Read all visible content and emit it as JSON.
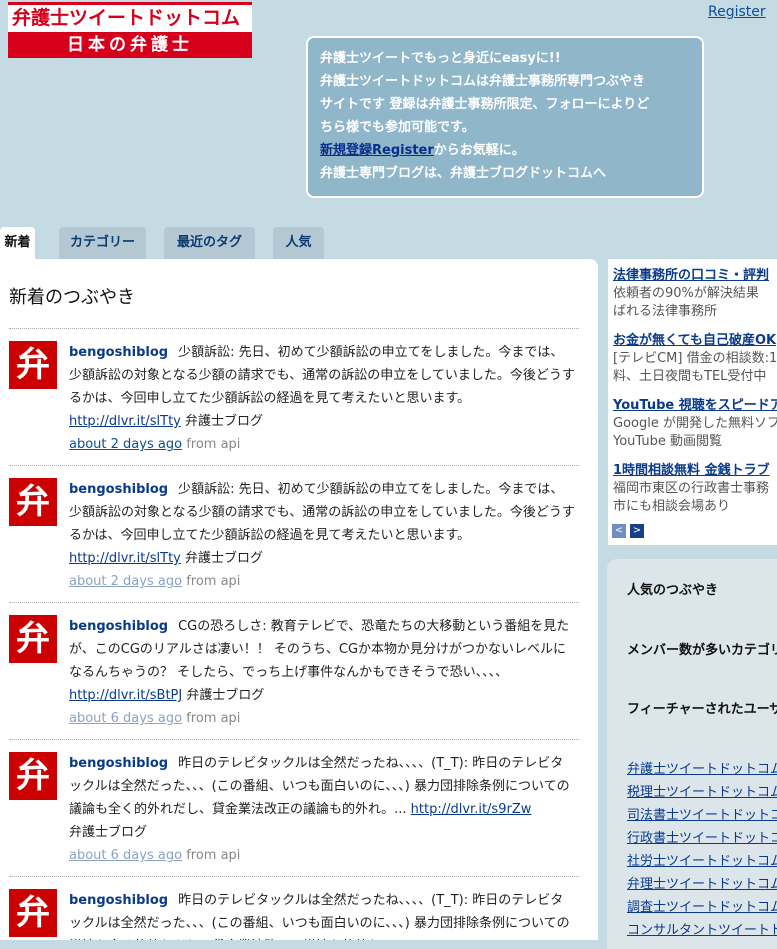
{
  "header": {
    "logo_top": "弁護士ツイートドットコム",
    "logo_bottom": "日本の弁護士",
    "register_link": "Register"
  },
  "info": {
    "line1": "弁護士ツイートでもっと身近にeasyに!!",
    "line2": "弁護士ツイートドットコムは弁護士事務所専門つぶやき",
    "line3": "サイトです 登録は弁護士事務所限定、フォローによりど",
    "line4": "ちら様でも参加可能です。",
    "signup_link": "新規登録Register",
    "line5_suffix": "からお気軽に。",
    "line6": "弁護士専門ブログは、弁護士ブログドットコムへ"
  },
  "tabs": [
    "新着",
    "カテゴリー",
    "最近のタグ",
    "人気"
  ],
  "main": {
    "title": "新着のつぶやき",
    "avatar_glyph": "弁",
    "tweets": [
      {
        "user": "bengoshiblog",
        "text": "少額訴訟: 先日、初めて少額訴訟の申立てをしました。今までは、少額訴訟の対象となる少額の請求でも、通常の訴訟の申立をしていました。今後どうするかは、今回申し立てた少額訴訟の経過を見て考えたいと思います。",
        "link": "http://dlvr.it/slTty",
        "suffix": "弁護士ブログ",
        "time": "about 2 days ago",
        "source": "from api"
      },
      {
        "user": "bengoshiblog",
        "text": "少額訴訟: 先日、初めて少額訴訟の申立てをしました。今までは、少額訴訟の対象となる少額の請求でも、通常の訴訟の申立をしていました。今後どうするかは、今回申し立てた少額訴訟の経過を見て考えたいと思います。",
        "link": "http://dlvr.it/slTty",
        "suffix": "弁護士ブログ",
        "time": "about 2 days ago",
        "source": "from api"
      },
      {
        "user": "bengoshiblog",
        "text": "CGの恐ろしさ: 教育テレビで、恐竜たちの大移動という番組を見たが、このCGのリアルさは凄い！！ そのうち、CGか本物か見分けがつかないレベルになるんちゃうの？ そしたら、でっち上げ事件なんかもできそうで恐い、、、、",
        "link": "http://dlvr.it/sBtPJ",
        "suffix": "弁護士ブログ",
        "time": "about 6 days ago",
        "source": "from api"
      },
      {
        "user": "bengoshiblog",
        "text": "昨日のテレビタックルは全然だったね、、、、(T_T): 昨日のテレビタックルは全然だった、、、(この番組、いつも面白いのに、、、) 暴力団排除条例についての議論も全く的外れだし、貸金業法改正の議論も的外れ。...",
        "link": "http://dlvr.it/s9rZw",
        "suffix": "弁護士ブログ",
        "time": "about 6 days ago",
        "source": "from api"
      },
      {
        "user": "bengoshiblog",
        "text": "昨日のテレビタックルは全然だったね、、、、(T_T): 昨日のテレビタックルは全然だった、、、(この番組、いつも面白いのに、、、) 暴力団排除条例についての議論も全く的外れだし、貸金業法改正の議論も的外れ。...",
        "link": "",
        "suffix": "",
        "time": "",
        "source": ""
      }
    ]
  },
  "ads": [
    {
      "title": "法律事務所の口コミ・評判",
      "desc1": "依頼者の90%が解決結果",
      "desc2": "ばれる法律事務所"
    },
    {
      "title": "お金が無くても自己破産OK",
      "desc1": "[テレビCM] 借金の相談数:1",
      "desc2": "料、土日夜間もTEL受付中"
    },
    {
      "title": "YouTube 視聴をスピードア",
      "desc1": "Google が開発した無料ソフ",
      "desc2": "YouTube 動画閲覧"
    },
    {
      "title": "1時間相談無料 金銭トラブ",
      "desc1": "福岡市東区の行政書士事務",
      "desc2": "市にも相談会場あり"
    }
  ],
  "ad_nav": {
    "prev": "<",
    "next": ">"
  },
  "sidebar": {
    "popular_heading": "人気のつぶやき",
    "members_heading": "メンバー数が多いカテゴリ",
    "featured_heading": "フィーチャーされたユーザ",
    "links": [
      "弁護士ツイートドットコム",
      "税理士ツイートドットコム",
      "司法書士ツイートドットコム",
      "行政書士ツイートドットコム",
      "社労士ツイートドットコム",
      "弁理士ツイートドットコム",
      "調査士ツイートドットコム",
      "コンサルタントツイートド"
    ]
  },
  "colors": {
    "brand_red": "#d6001c",
    "page_bg": "#c5dbe4",
    "info_box": "#8fb6c9",
    "link": "#0a3a8a"
  }
}
